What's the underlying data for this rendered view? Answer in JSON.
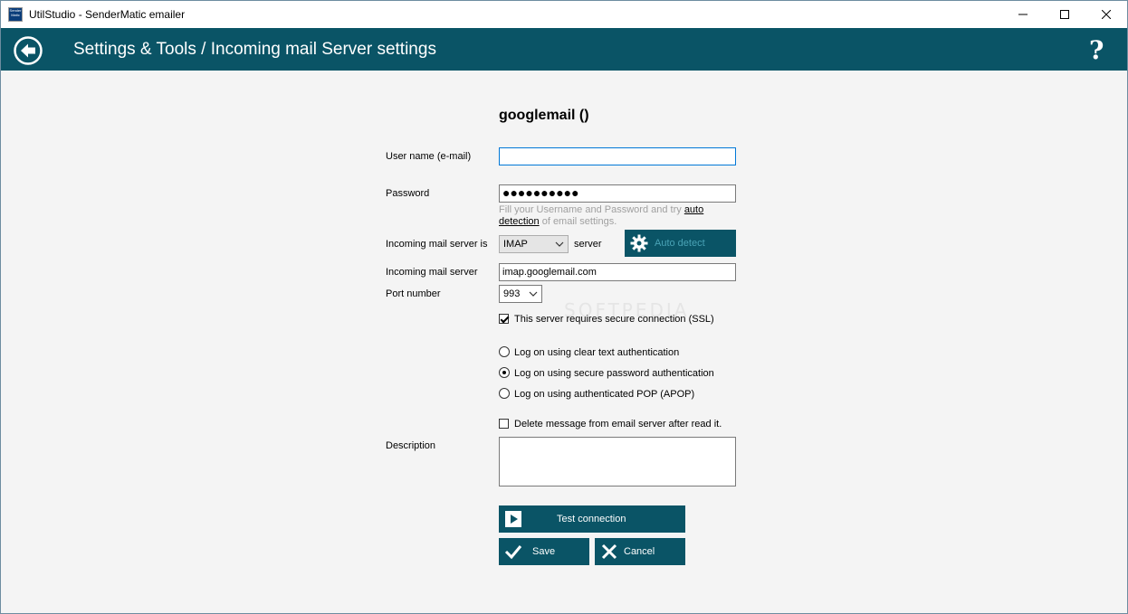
{
  "window": {
    "title": "UtilStudio - SenderMatic emailer",
    "icon_text": "Sender Matic"
  },
  "header": {
    "title": "Settings & Tools / Incoming mail Server settings",
    "help_label": "?",
    "back_icon": "back-arrow-icon",
    "background_color": "#0a5466"
  },
  "form": {
    "title": "googlemail ()",
    "username_label": "User name (e-mail)",
    "username_value": "",
    "password_label": "Password",
    "password_masked": "●●●●●●●●●●",
    "hint_prefix": "Fill your Username and Password and try ",
    "hint_link_1": "auto",
    "hint_link_2": "detection",
    "hint_suffix": " of email settings.",
    "server_type_label": "Incoming mail server is",
    "server_type_value": "IMAP",
    "server_suffix": "server",
    "auto_detect_label": "Auto detect",
    "server_label": "Incoming mail server",
    "server_value": "imap.googlemail.com",
    "port_label": "Port number",
    "port_value": "993",
    "ssl_label": "This server requires secure connection (SSL)",
    "ssl_checked": true,
    "auth_options": [
      {
        "label": "Log on using clear text authentication",
        "selected": false
      },
      {
        "label": "Log on using secure password authentication",
        "selected": true
      },
      {
        "label": "Log on using authenticated POP (APOP)",
        "selected": false
      }
    ],
    "delete_label": "Delete message from email server after read it.",
    "delete_checked": false,
    "description_label": "Description",
    "description_value": ""
  },
  "buttons": {
    "test_connection": "Test connection",
    "save": "Save",
    "cancel": "Cancel"
  },
  "watermark": "SOFTPEDIA"
}
